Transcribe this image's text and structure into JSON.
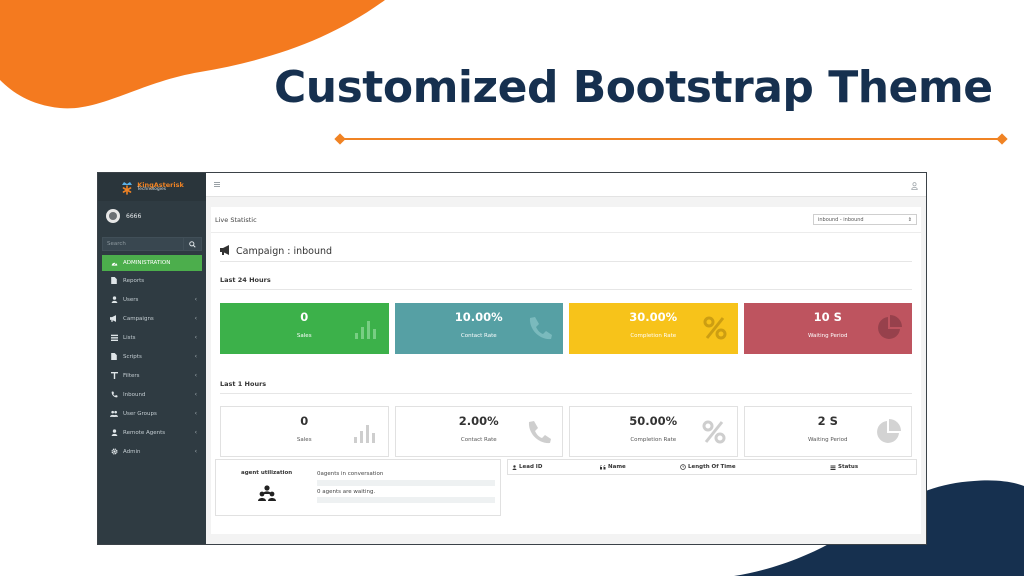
{
  "slide": {
    "title": "Customized Bootstrap Theme",
    "colors": {
      "orange": "#f08324",
      "navy": "#16304f"
    }
  },
  "app": {
    "logo": {
      "brand": "KingAsterisk",
      "sub": "Technologies",
      "icon": "asterisk-logo-icon"
    },
    "user": {
      "name": "6666",
      "icon": "avatar-icon"
    },
    "search": {
      "placeholder": "Search",
      "icon": "search-icon"
    },
    "nav": [
      {
        "label": "ADMINISTRATION",
        "icon": "dashboard-icon",
        "active": true
      },
      {
        "label": "Reports",
        "icon": "file-icon"
      },
      {
        "label": "Users",
        "icon": "user-icon",
        "chevron": "‹"
      },
      {
        "label": "Campaigns",
        "icon": "megaphone-icon",
        "chevron": "‹"
      },
      {
        "label": "Lists",
        "icon": "list-icon",
        "chevron": "‹"
      },
      {
        "label": "Scripts",
        "icon": "file-icon",
        "chevron": "‹"
      },
      {
        "label": "Filters",
        "icon": "filter-icon",
        "chevron": "‹"
      },
      {
        "label": "Inbound",
        "icon": "phone-icon",
        "chevron": "‹"
      },
      {
        "label": "User Groups",
        "icon": "users-icon",
        "chevron": "‹"
      },
      {
        "label": "Remote Agents",
        "icon": "user-icon",
        "chevron": "‹"
      },
      {
        "label": "Admin",
        "icon": "gear-icon",
        "chevron": "‹"
      }
    ],
    "topbar": {
      "menu_icon": "hamburger-icon",
      "user_icon": "user-icon"
    },
    "panel": {
      "title": "Live Statistic",
      "select_value": "inbound - inbound",
      "select_caret": "⇕",
      "campaign": "Campaign : inbound",
      "campaign_icon": "megaphone-icon"
    },
    "last24": {
      "title": "Last 24 Hours",
      "cards": [
        {
          "value": "0",
          "label": "Sales",
          "color": "#3cb14a",
          "icon": "bar-chart-icon"
        },
        {
          "value": "10.00%",
          "label": "Contact Rate",
          "color": "#56a0a4",
          "icon": "phone-icon"
        },
        {
          "value": "30.00%",
          "label": "Completion Rate",
          "color": "#f7c31a",
          "icon": "percent-icon"
        },
        {
          "value": "10 S",
          "label": "Waiting Period",
          "color": "#be545f",
          "icon": "pie-chart-icon"
        }
      ]
    },
    "last1": {
      "title": "Last 1 Hours",
      "cards": [
        {
          "value": "0",
          "label": "Sales",
          "icon": "bar-chart-icon"
        },
        {
          "value": "2.00%",
          "label": "Contact Rate",
          "icon": "phone-icon"
        },
        {
          "value": "50.00%",
          "label": "Completion Rate",
          "icon": "percent-icon"
        },
        {
          "value": "2 S",
          "label": "Waiting Period",
          "icon": "pie-chart-icon"
        }
      ]
    },
    "utilization": {
      "title": "agent utilization",
      "icon": "users-group-icon",
      "line1": "0agents in conversation",
      "line2": "0 agents are waiting."
    },
    "table": {
      "headers": [
        {
          "label": "Lead ID",
          "icon": "user-icon"
        },
        {
          "label": "Name",
          "icon": "quote-icon"
        },
        {
          "label": "Length Of Time",
          "icon": "clock-icon"
        },
        {
          "label": "Status",
          "icon": "list-icon"
        }
      ]
    }
  }
}
